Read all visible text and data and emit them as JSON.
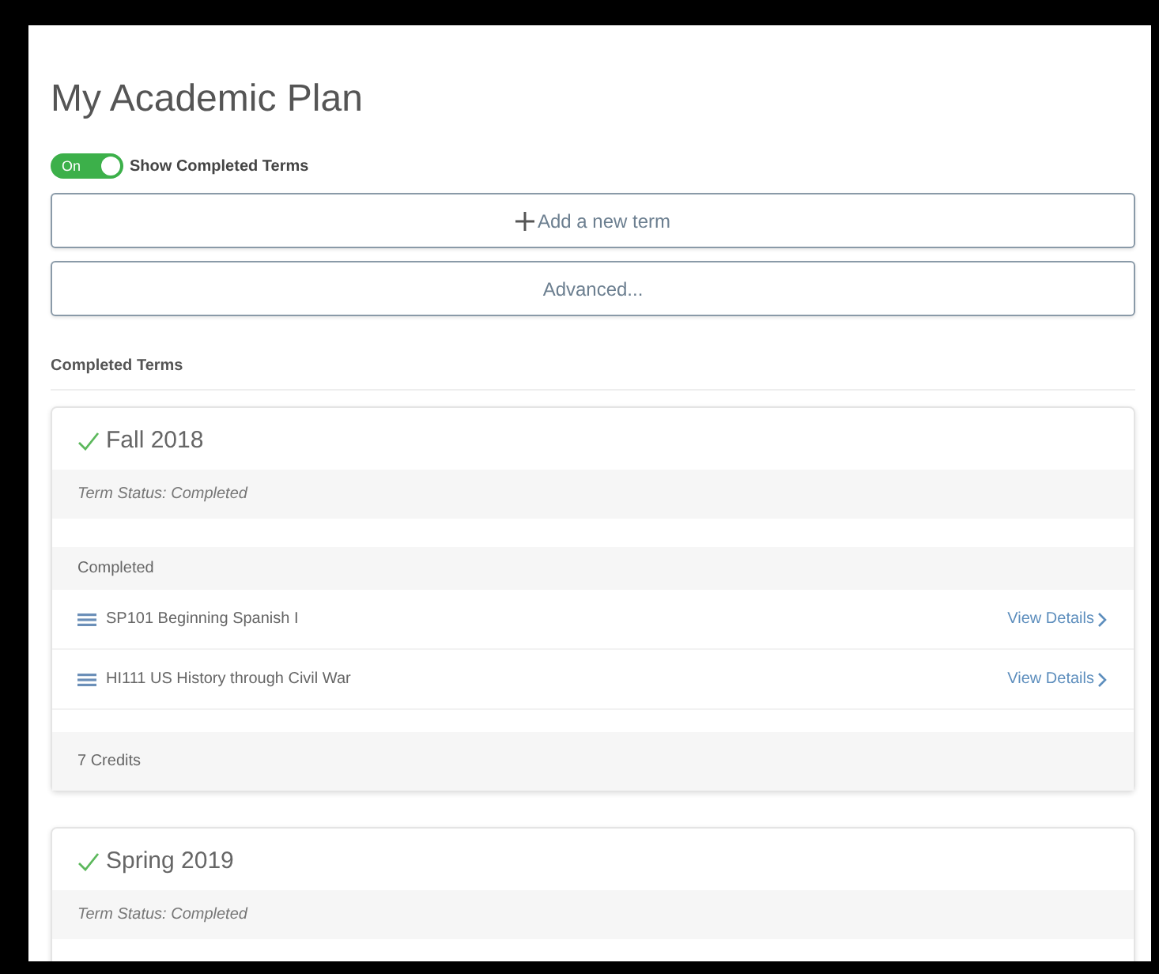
{
  "title": "My Academic Plan",
  "toggle": {
    "on": true,
    "state_label": "On",
    "label": "Show Completed Terms"
  },
  "buttons": [
    {
      "kind": "add",
      "label": "Add a new term"
    },
    {
      "kind": "plain",
      "label": "Advanced..."
    }
  ],
  "section_heading": "Completed Terms",
  "terms": [
    {
      "name": "Fall 2018",
      "completed": true,
      "status": "Term Status: Completed",
      "group_heading": "Completed",
      "courses": [
        {
          "name": "SP101 Beginning Spanish I",
          "link": "View Details"
        },
        {
          "name": "HI111 US History through Civil War",
          "link": "View Details"
        }
      ],
      "credits": "7 Credits"
    },
    {
      "name": "Spring 2019",
      "completed": true,
      "status": "Term Status: Completed"
    }
  ]
}
